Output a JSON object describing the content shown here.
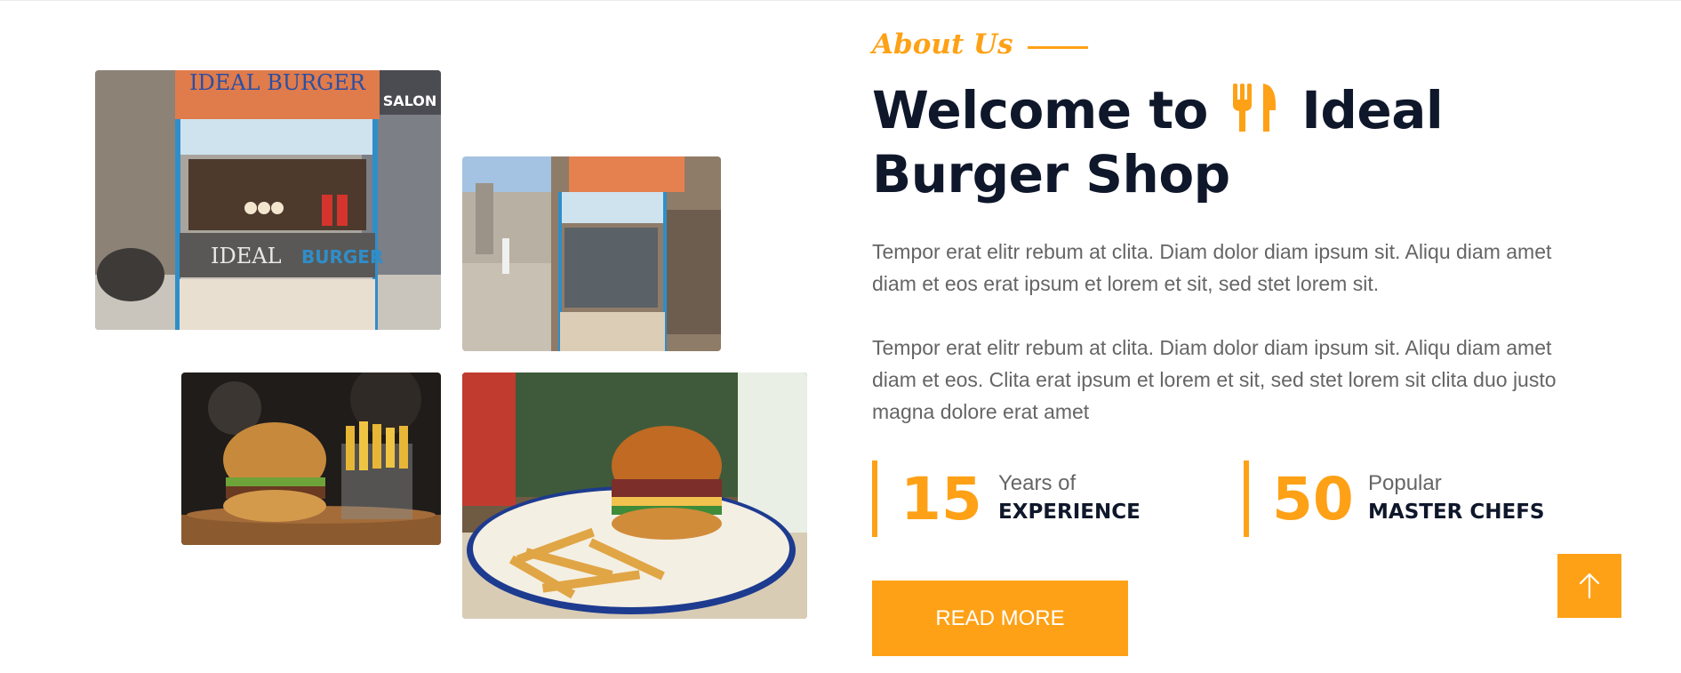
{
  "about": {
    "label": "About Us",
    "heading_pre": "Welcome to",
    "heading_post": "Ideal Burger Shop",
    "heading_icon": "utensils-icon"
  },
  "paragraphs": [
    "Tempor erat elitr rebum at clita. Diam dolor diam ipsum sit. Aliqu diam amet diam et eos erat ipsum et lorem et sit, sed stet lorem sit.",
    "Tempor erat elitr rebum at clita. Diam dolor diam ipsum sit. Aliqu diam amet diam et eos. Clita erat ipsum et lorem et sit, sed stet lorem sit clita duo justo magna dolore erat amet"
  ],
  "stats": [
    {
      "number": "15",
      "small": "Years of",
      "big": "EXPERIENCE"
    },
    {
      "number": "50",
      "small": "Popular",
      "big": "MASTER CHEFS"
    }
  ],
  "buttons": {
    "read_more": "READ MORE",
    "back_to_top_icon": "arrow-up-icon"
  },
  "photos": [
    {
      "name": "burger-stall-front-photo",
      "sign_text": "IDEAL BURGER",
      "cart_text": "IDEAL",
      "cart_text_2": "BURGER",
      "salon_text": "SALON"
    },
    {
      "name": "burger-stall-street-photo"
    },
    {
      "name": "burger-and-fries-board-photo"
    },
    {
      "name": "burger-and-fries-bowl-photo"
    }
  ],
  "colors": {
    "accent": "#FEA116",
    "heading": "#0F172B",
    "body_text": "#666565"
  }
}
